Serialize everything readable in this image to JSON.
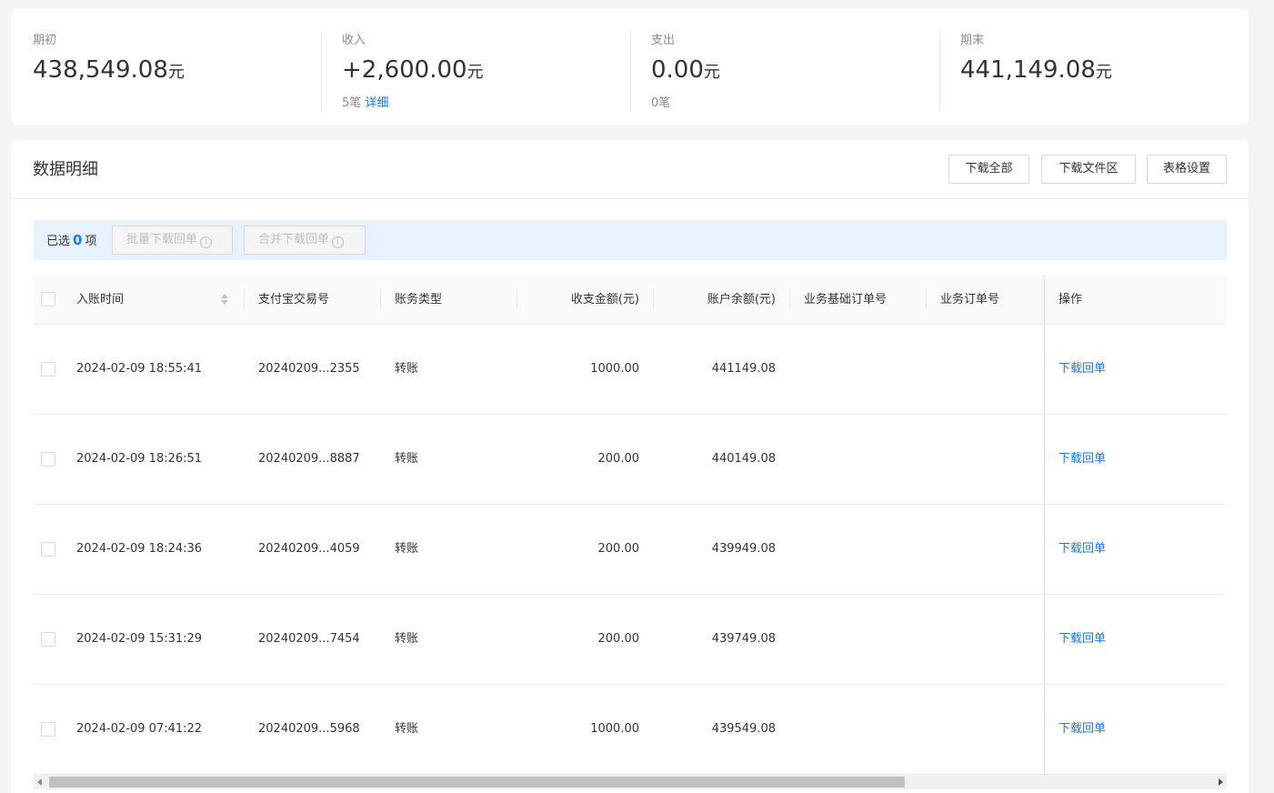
{
  "summary": {
    "opening": {
      "label": "期初",
      "amount": "438,549.08",
      "unit": "元"
    },
    "income": {
      "label": "收入",
      "amount": "+2,600.00",
      "unit": "元",
      "count": "5笔",
      "detail_link": "详细"
    },
    "expense": {
      "label": "支出",
      "amount": "0.00",
      "unit": "元",
      "count": "0笔"
    },
    "closing": {
      "label": "期末",
      "amount": "441,149.08",
      "unit": "元"
    }
  },
  "panel": {
    "title": "数据明细",
    "buttons": {
      "download_all": "下载全部",
      "download_files": "下载文件区",
      "table_settings": "表格设置"
    }
  },
  "selection": {
    "prefix": "已选",
    "count": "0",
    "suffix": "项",
    "batch_download": "批量下载回单",
    "merge_download": "合并下载回单",
    "info_icon": "i"
  },
  "table": {
    "columns": {
      "time": "入账时间",
      "trade_no": "支付宝交易号",
      "type": "账务类型",
      "amount": "收支金额(元)",
      "balance": "账户余额(元)",
      "base_order": "业务基础订单号",
      "order": "业务订单号",
      "action": "操作"
    },
    "rows": [
      {
        "time": "2024-02-09 18:55:41",
        "trade_no": "20240209...2355",
        "type": "转账",
        "amount": "1000.00",
        "balance": "441149.08",
        "base_order": "",
        "order": "",
        "action": "下载回单"
      },
      {
        "time": "2024-02-09 18:26:51",
        "trade_no": "20240209...8887",
        "type": "转账",
        "amount": "200.00",
        "balance": "440149.08",
        "base_order": "",
        "order": "",
        "action": "下载回单"
      },
      {
        "time": "2024-02-09 18:24:36",
        "trade_no": "20240209...4059",
        "type": "转账",
        "amount": "200.00",
        "balance": "439949.08",
        "base_order": "",
        "order": "",
        "action": "下载回单"
      },
      {
        "time": "2024-02-09 15:31:29",
        "trade_no": "20240209...7454",
        "type": "转账",
        "amount": "200.00",
        "balance": "439749.08",
        "base_order": "",
        "order": "",
        "action": "下载回单"
      },
      {
        "time": "2024-02-09 07:41:22",
        "trade_no": "20240209...5968",
        "type": "转账",
        "amount": "1000.00",
        "balance": "439549.08",
        "base_order": "",
        "order": "",
        "action": "下载回单"
      }
    ]
  },
  "colors": {
    "accent": "#1677ff",
    "selection_bg": "#e8f1fe"
  }
}
